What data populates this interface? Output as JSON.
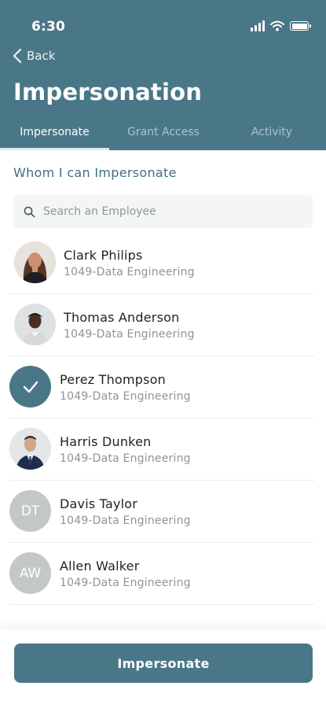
{
  "status_bar": {
    "time": "6:30",
    "icons": [
      "signal-icon",
      "wifi-icon",
      "battery-icon"
    ]
  },
  "header": {
    "back_label": "Back",
    "title": "Impersonation",
    "background_color": "#4a7787"
  },
  "tabs": [
    {
      "label": "Impersonate",
      "active": true
    },
    {
      "label": "Grant Access",
      "active": false
    },
    {
      "label": "Activity",
      "active": false
    }
  ],
  "section_title": "Whom I can Impersonate",
  "search": {
    "placeholder": "Search an Employee",
    "value": ""
  },
  "employees": [
    {
      "name": "Clark Philips",
      "department": "1049-Data Engineering",
      "avatar": "photo",
      "selected": false
    },
    {
      "name": "Thomas Anderson",
      "department": "1049-Data Engineering",
      "avatar": "photo",
      "selected": false
    },
    {
      "name": "Perez Thompson",
      "department": "1049-Data Engineering",
      "avatar": "check",
      "selected": true
    },
    {
      "name": "Harris Dunken",
      "department": "1049-Data Engineering",
      "avatar": "photo",
      "selected": false
    },
    {
      "name": "Davis Taylor",
      "department": "1049-Data Engineering",
      "avatar": "initials",
      "initials": "DT",
      "selected": false
    },
    {
      "name": "Allen Walker",
      "department": "1049-Data Engineering",
      "avatar": "initials",
      "initials": "AW",
      "selected": false
    }
  ],
  "footer": {
    "button_label": "Impersonate"
  },
  "colors": {
    "accent": "#4a7787",
    "section_title": "#3e6f80",
    "initials_avatar": "#c4c7c7"
  }
}
